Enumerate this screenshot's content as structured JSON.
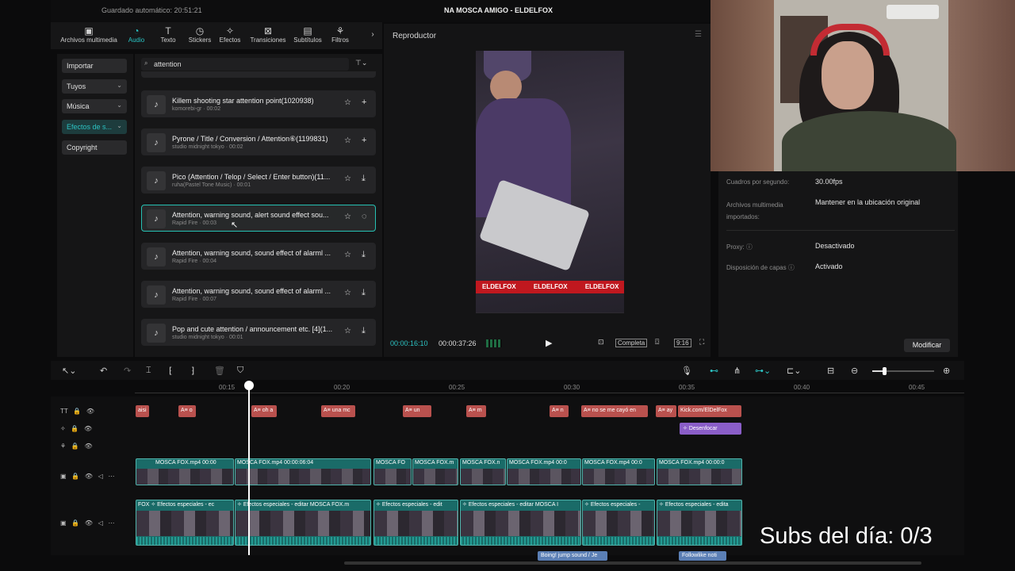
{
  "header": {
    "autosave": "Guardado automático: 20:51:21",
    "title": "NA MOSCA AMIGO - ELDELFOX"
  },
  "toolbar": [
    {
      "label": "Archivos multimedia",
      "icon": "media-icon",
      "glyph": "▣"
    },
    {
      "label": "Audio",
      "icon": "audio-icon",
      "glyph": "◔"
    },
    {
      "label": "Texto",
      "icon": "text-icon",
      "glyph": "T"
    },
    {
      "label": "Stickers",
      "icon": "sticker-icon",
      "glyph": "◷"
    },
    {
      "label": "Efectos",
      "icon": "effects-icon",
      "glyph": "✧"
    },
    {
      "label": "Transiciones",
      "icon": "transitions-icon",
      "glyph": "⊠"
    },
    {
      "label": "Subtítulos",
      "icon": "subtitles-icon",
      "glyph": "▤"
    },
    {
      "label": "Filtros",
      "icon": "filters-icon",
      "glyph": "⚘"
    }
  ],
  "nav": {
    "importar": "Importar",
    "tuyos": "Tuyos",
    "musica": "Música",
    "efectos": "Efectos de s...",
    "copyright": "Copyright"
  },
  "search": {
    "value": "attention"
  },
  "sounds": [
    {
      "title": "Killem shooting star attention point(1020938)",
      "meta": "komorebi-gr · 00:02",
      "action": "+"
    },
    {
      "title": "Pyrone / Title / Conversion / Attention⑥(1199831)",
      "meta": "studio midnight tokyo · 00:02",
      "action": "+"
    },
    {
      "title": "Pico (Attention / Telop / Select / Enter button)(11...",
      "meta": "ruha(Pastel Tone Music) · 00:01",
      "action": "⤓"
    },
    {
      "title": "Attention, warning sound, alert sound effect sou...",
      "meta": "Rapid Fire · 00:03",
      "action": "◌"
    },
    {
      "title": "Attention, warning sound, sound effect of alarml ...",
      "meta": "Rapid Fire · 00:04",
      "action": "⤓"
    },
    {
      "title": "Attention, warning sound, sound effect of alarml ...",
      "meta": "Rapid Fire · 00:07",
      "action": "⤓"
    },
    {
      "title": "Pop and cute attention / announcement etc. [4](1...",
      "meta": "studio midnight tokyo · 00:01",
      "action": "⤓"
    }
  ],
  "player": {
    "title": "Reproductor",
    "current": "00:00:16:10",
    "total": "00:00:37:26",
    "full": "Completa",
    "ratio": "9:16",
    "watermark": "ELDELFOX"
  },
  "details": {
    "fps_label": "Cuadros por segundo:",
    "fps": "30.00fps",
    "media_label": "Archivos multimedia importados:",
    "media": "Mantener en la ubicación original",
    "proxy_label": "Proxy:",
    "proxy": "Desactivado",
    "layers_label": "Disposición de capas",
    "layers": "Activado",
    "modify": "Modificar"
  },
  "timeline": {
    "ticks": [
      "00:15",
      "00:20",
      "00:25",
      "00:30",
      "00:35",
      "00:40",
      "00:45"
    ],
    "text_clips": [
      "aisi",
      "A≡ o",
      "A≡ oh a",
      "A≡ una mc",
      "A≡ un",
      "A≡ m",
      "A≡ n",
      "A≡ no se me cayó en",
      "A≡ ay",
      "Kick.com/ElDelFox"
    ],
    "blur": "Desenfocar",
    "video_clips": [
      "MOSCA FOX.mp4  00:00",
      "MOSCA FOX.mp4  00:00:06:04",
      "MOSCA FO",
      "MOSCA FOX.m",
      "MOSCA FOX.n",
      "MOSCA FOX.mp4  00:0",
      "MOSCA FOX.mp4  00:0",
      "MOSCA FOX.mp4  00:00:0"
    ],
    "effect_clips": [
      "FOX",
      "Efectos especiales - ec",
      "Efectos especiales - editar  MOSCA FOX.m",
      "Efectos especiales - edit",
      "Efectos especiales - editar  MOSCA I",
      "Efectos especiales -",
      "Efectos especiales - edita"
    ],
    "audio_clips": [
      "Boing! jump sound / Je",
      "Followlike noti"
    ]
  },
  "overlay": {
    "subs": "Subs del día: 0/3"
  }
}
